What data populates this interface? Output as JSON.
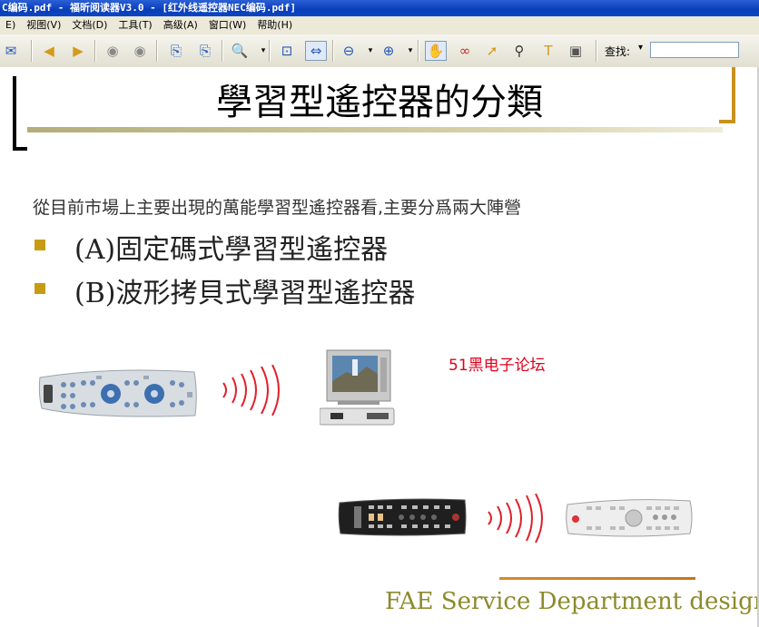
{
  "window": {
    "title": "C编码.pdf - 福昕阅读器V3.0 - [红外线遥控器NEC编码.pdf]"
  },
  "menu": {
    "items": [
      "E)",
      "视图(V)",
      "文档(D)",
      "工具(T)",
      "高级(A)",
      "窗口(W)",
      "帮助(H)"
    ]
  },
  "toolbar": {
    "find_label": "查找:",
    "find_value": ""
  },
  "slide": {
    "title": "學習型遙控器的分類",
    "intro": "從目前市場上主要出現的萬能學習型遙控器看,主要分爲兩大陣營",
    "bullets": [
      "(A)固定碼式學習型遙控器",
      "(B)波形拷貝式學習型遙控器"
    ],
    "watermark": "51黑电子论坛",
    "footer": "FAE Service Department designed"
  },
  "icons": {
    "accent": "#c79c14",
    "wave_color": "#e0202a"
  }
}
